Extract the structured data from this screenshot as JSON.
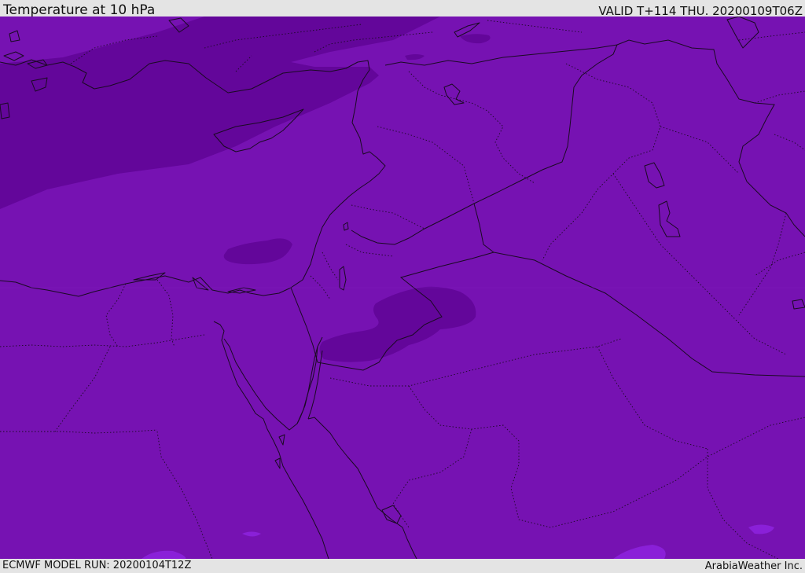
{
  "header": {
    "title": "Temperature at 10 hPa",
    "valid_time": "VALID T+114 THU. 20200109T06Z"
  },
  "footer": {
    "model_run": "ECMWF MODEL RUN: 20200104T12Z",
    "credit": "ArabiaWeather Inc."
  },
  "map": {
    "colors": {
      "base_fill": "#7612b2",
      "cold_fill": "#63069a",
      "warm_fill": "#8a20d8"
    }
  }
}
